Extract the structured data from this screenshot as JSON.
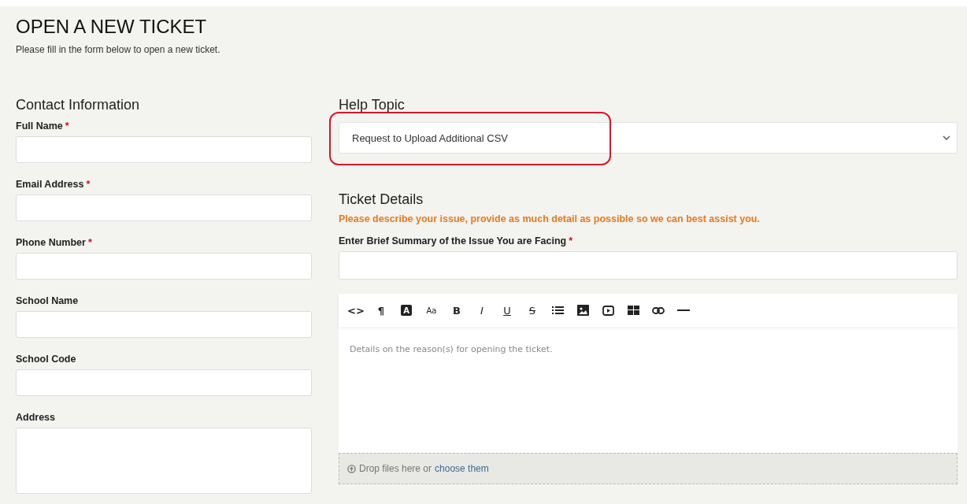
{
  "page": {
    "title": "OPEN A NEW TICKET",
    "subtitle": "Please fill in the form below to open a new ticket."
  },
  "contact": {
    "heading": "Contact Information",
    "fields": [
      {
        "label": "Full Name",
        "required_mark": "*",
        "kind": "input"
      },
      {
        "label": "Email Address",
        "required_mark": "*",
        "kind": "input"
      },
      {
        "label": "Phone Number",
        "required_mark": "*",
        "kind": "input"
      },
      {
        "label": "School Name",
        "kind": "input"
      },
      {
        "label": "School Code",
        "kind": "input"
      },
      {
        "label": "Address",
        "kind": "textarea"
      }
    ]
  },
  "help_topic": {
    "heading": "Help Topic",
    "value": "Request to Upload Additional CSV",
    "highlighted": true
  },
  "ticket_details": {
    "heading": "Ticket Details",
    "instructions": "Please describe your issue, provide as much detail as possible so we can best assist you.",
    "summary": {
      "label": "Enter Brief Summary of the Issue You are Facing",
      "required_mark": "*"
    },
    "editor": {
      "toolbar": [
        {
          "kind": "code",
          "glyph": "<>"
        },
        {
          "kind": "paragraph",
          "glyph": "¶"
        },
        {
          "kind": "inverse",
          "glyph": "A"
        },
        {
          "kind": "small",
          "glyph": "Aa"
        },
        {
          "kind": "bold",
          "glyph": "B"
        },
        {
          "kind": "italic",
          "glyph": "I"
        },
        {
          "kind": "underline",
          "glyph": "U"
        },
        {
          "kind": "strike",
          "glyph": "S"
        },
        {
          "kind": "list"
        },
        {
          "kind": "image"
        },
        {
          "kind": "video"
        },
        {
          "kind": "table"
        },
        {
          "kind": "link"
        },
        {
          "kind": "rule"
        }
      ],
      "placeholder": "Details on the reason(s) for opening the ticket.",
      "dropzone": {
        "text": "Drop files here or",
        "link": "choose them"
      }
    }
  }
}
